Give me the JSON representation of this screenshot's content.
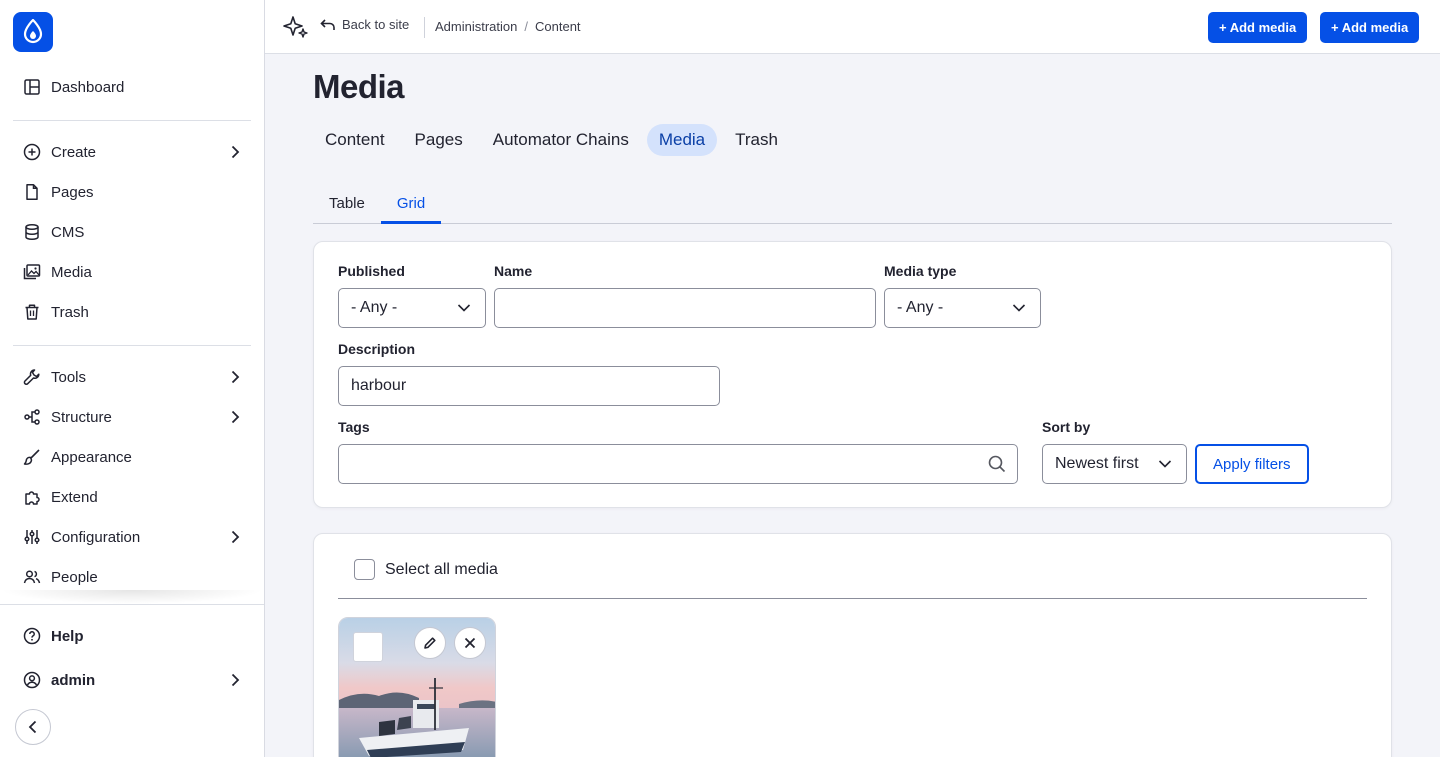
{
  "sidebar": {
    "items_top": [
      {
        "label": "Dashboard",
        "icon": "dashboard-icon"
      }
    ],
    "items_content": [
      {
        "label": "Create",
        "icon": "plus-circle-icon",
        "has_children": true
      },
      {
        "label": "Pages",
        "icon": "file-icon",
        "has_children": false
      },
      {
        "label": "CMS",
        "icon": "database-icon",
        "has_children": false
      },
      {
        "label": "Media",
        "icon": "image-icon",
        "has_children": false
      },
      {
        "label": "Trash",
        "icon": "trash-icon",
        "has_children": false
      }
    ],
    "items_admin": [
      {
        "label": "Tools",
        "icon": "wrench-icon",
        "has_children": true
      },
      {
        "label": "Structure",
        "icon": "structure-icon",
        "has_children": true
      },
      {
        "label": "Appearance",
        "icon": "brush-icon",
        "has_children": false
      },
      {
        "label": "Extend",
        "icon": "puzzle-icon",
        "has_children": false
      },
      {
        "label": "Configuration",
        "icon": "sliders-icon",
        "has_children": true
      },
      {
        "label": "People",
        "icon": "people-icon",
        "has_children": false
      }
    ],
    "help_label": "Help",
    "user_label": "admin"
  },
  "topbar": {
    "back_label": "Back to site",
    "breadcrumbs": [
      "Administration",
      "Content"
    ],
    "add_media_label_1": "+ Add media",
    "add_media_label_2": "+ Add media"
  },
  "page": {
    "title": "Media",
    "primary_tabs": [
      {
        "label": "Content",
        "active": false
      },
      {
        "label": "Pages",
        "active": false
      },
      {
        "label": "Automator Chains",
        "active": false
      },
      {
        "label": "Media",
        "active": true
      },
      {
        "label": "Trash",
        "active": false
      }
    ],
    "secondary_tabs": [
      {
        "label": "Table",
        "active": false
      },
      {
        "label": "Grid",
        "active": true
      }
    ]
  },
  "filters": {
    "published_label": "Published",
    "published_value": "- Any -",
    "name_label": "Name",
    "name_value": "",
    "media_type_label": "Media type",
    "media_type_value": "- Any -",
    "description_label": "Description",
    "description_value": "harbour",
    "tags_label": "Tags",
    "tags_value": "",
    "sort_label": "Sort by",
    "sort_value": "Newest first",
    "apply_label": "Apply filters"
  },
  "grid": {
    "select_all_label": "Select all media"
  },
  "colors": {
    "accent": "#0550e6",
    "active_tab_bg": "#d4e2fc"
  }
}
